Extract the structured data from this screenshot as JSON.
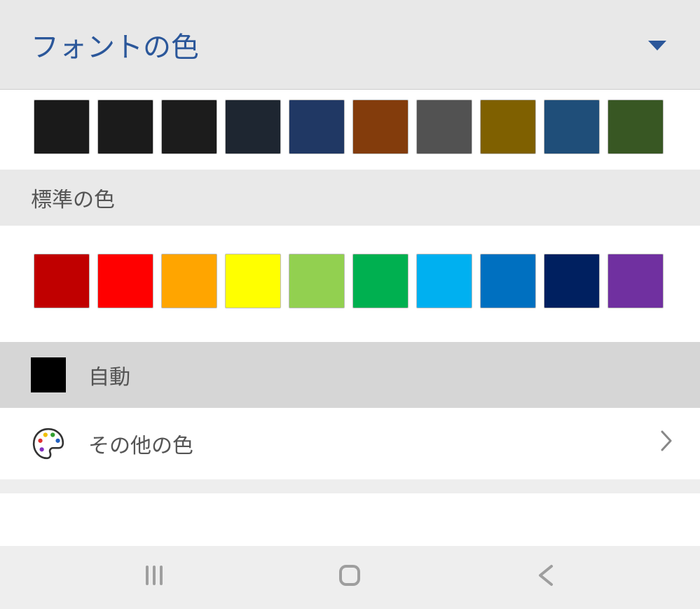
{
  "header": {
    "title": "フォントの色"
  },
  "sections": {
    "standard_label": "標準の色",
    "auto_label": "自動",
    "other_label": "その他の色"
  },
  "dark_row": [
    "#1a1a1a",
    "#1b1b1b",
    "#1c1c1c",
    "#1e2631",
    "#203864",
    "#833c0c",
    "#525252",
    "#7f6000",
    "#1f4e79",
    "#385723"
  ],
  "standard_row": [
    "#c00000",
    "#ff0000",
    "#ffa500",
    "#ffff00",
    "#92d050",
    "#00b050",
    "#00b0f0",
    "#0070c0",
    "#002060",
    "#7030a0"
  ],
  "auto_color": "#000000"
}
